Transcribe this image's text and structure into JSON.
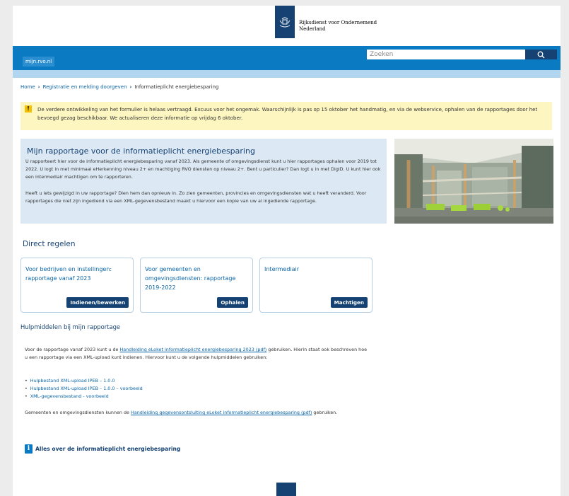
{
  "header": {
    "logo_line1": "Rijksdienst voor Ondernemend",
    "logo_line2": "Nederland"
  },
  "nav": {
    "home": "mijn.rvo.nl",
    "search_placeholder": "Zoeken"
  },
  "breadcrumb": {
    "home": "Home",
    "parent": "Registratie en melding doorgeven",
    "current": "Informatieplicht energiebesparing"
  },
  "alert": {
    "icon": "!",
    "text": "De verdere ontwikkeling van het formulier is helaas vertraagd. Excuus voor het ongemak. Waarschijnlijk is pas op 15 oktober het handmatig, en via de webservice, ophalen van de rapportages door het bevoegd gezag beschikbaar. We actualiseren deze informatie op vrijdag 6 oktober."
  },
  "intro": {
    "title": "Mijn rapportage voor de informatieplicht energiebesparing",
    "p1": "U rapporteert hier voor de informatieplicht energiebesparing vanaf 2023. Als gemeente of omgevingsdienst kunt u hier rapportages ophalen voor 2019 tot 2022. U logt in met minimaal eHerkenning niveau 2+ en machtiging RVO diensten op niveau 2+. Bent u particulier? Dan logt u in met DigiD. U kunt hier ook een intermediair machtigen om te rapporteren.",
    "p2": "Heeft u iets gewijzigd in uw rapportage? Dien hem dan opnieuw in. Zo zien gemeenten, provincies en omgevingsdiensten wat u heeft veranderd. Voor rapportages die niet zijn ingediend via een XML-gegevensbestand maakt u hiervoor een kopie van uw al ingediende rapportage."
  },
  "direct": {
    "title": "Direct regelen",
    "cards": [
      {
        "text": "Voor bedrijven en instellingen: rapportage vanaf 2023",
        "button": "Indienen/bewerken"
      },
      {
        "text": "Voor gemeenten en omgevingsdiensten: rapportage 2019-2022",
        "button": "Ophalen"
      },
      {
        "text": "Intermediair",
        "button": "Machtigen"
      }
    ]
  },
  "help": {
    "title": "Hulpmiddelen bij mijn rapportage",
    "p1_before": "Voor de rapportage vanaf 2023 kunt u de ",
    "p1_link": "Handleiding eLoket informatieplicht energiebesparing 2023 (pdf)",
    "p1_after": " gebruiken. Hierin staat ook beschreven hoe u een rapportage via een XML-upload kunt indienen. Hiervoor kunt u de volgende hulpmiddelen gebruiken:",
    "links": [
      "Hulpbestand XML-upload IPEB – 1.0.0",
      "Hulpbestand XML-upload IPEB – 1.0.0 – voorbeeld",
      "XML-gegevensbestand - voorbeeld"
    ],
    "p2_before": "Gemeenten en omgevingsdiensten kunnen de ",
    "p2_link": "Handleiding gegevensontsluiting eLoket informatieplicht energiebesparing (pdf)",
    "p2_after": " gebruiken."
  },
  "info": {
    "icon": "i",
    "label": "Alles over de informatieplicht energiebesparing"
  },
  "colors": {
    "brand_dark": "#154273",
    "nav_blue": "#0a7bc2",
    "link": "#0a65a8",
    "alert_bg": "#fef6c0",
    "intro_bg": "#dce9f4"
  }
}
